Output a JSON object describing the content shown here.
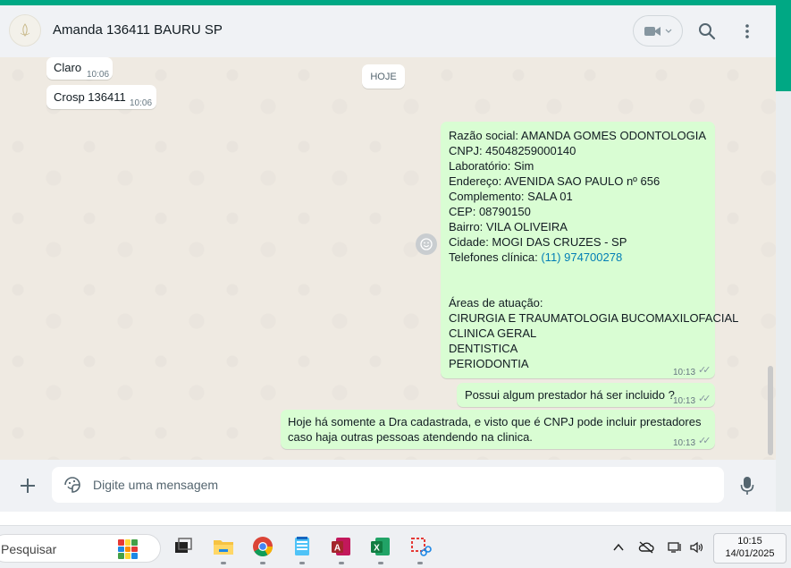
{
  "colors": {
    "accent": "#00a884",
    "incoming": "#ffffff",
    "outgoing": "#d9fdd3",
    "link": "#027eb5"
  },
  "header": {
    "title": "Amanda 136411 BAURU SP",
    "avatar_icon": "avatar-logo",
    "video_icon": "video-camera-icon",
    "search_icon": "search-icon",
    "menu_icon": "more-vertical-icon"
  },
  "chat": {
    "date_chip": "HOJE",
    "incoming": [
      {
        "text": "Claro",
        "time": "10:06"
      },
      {
        "text": "Crosp 136411",
        "time": "10:06"
      }
    ],
    "company_message": {
      "lines": [
        "Razão social: AMANDA GOMES ODONTOLOGIA",
        "CNPJ: 45048259000140",
        "Laboratório: Sim",
        "Endereço: AVENIDA SAO PAULO nº 656",
        "Complemento: SALA 01",
        "CEP: 08790150",
        "Bairro: VILA OLIVEIRA",
        "Cidade: MOGI DAS CRUZES - SP"
      ],
      "phone_label": "Telefones clínica: ",
      "phone_link": "(11) 974700278",
      "areas_title": "Áreas de atuação:",
      "areas": [
        "CIRURGIA E TRAUMATOLOGIA BUCOMAXILOFACIAL",
        "CLINICA GERAL",
        "DENTISTICA",
        "PERIODONTIA"
      ],
      "time": "10:13",
      "status": "read"
    },
    "question_message": {
      "text": "Possui algum prestador há ser incluido ?",
      "time": "10:13",
      "status": "read"
    },
    "answer_message": {
      "line1": "Hoje há somente a Dra cadastrada, e visto que é CNPJ pode incluir prestadores",
      "line2": "caso haja outras pessoas atendendo na clinica.",
      "time": "10:13",
      "status": "read"
    }
  },
  "composer": {
    "placeholder": "Digite uma mensagem",
    "value": "",
    "plus_icon": "plus-icon",
    "sticker_icon": "sticker-icon",
    "mic_icon": "microphone-icon"
  },
  "taskbar": {
    "search_placeholder": "Pesquisar",
    "apps": [
      "task-view-icon",
      "file-explorer-icon",
      "chrome-icon",
      "notepad-icon",
      "access-icon",
      "excel-icon",
      "snipping-tool-icon"
    ],
    "tray": [
      "chevron-up-icon",
      "onedrive-offline-icon",
      "network-icon",
      "volume-icon"
    ],
    "clock_time": "10:15",
    "clock_date": "14/01/2025"
  }
}
